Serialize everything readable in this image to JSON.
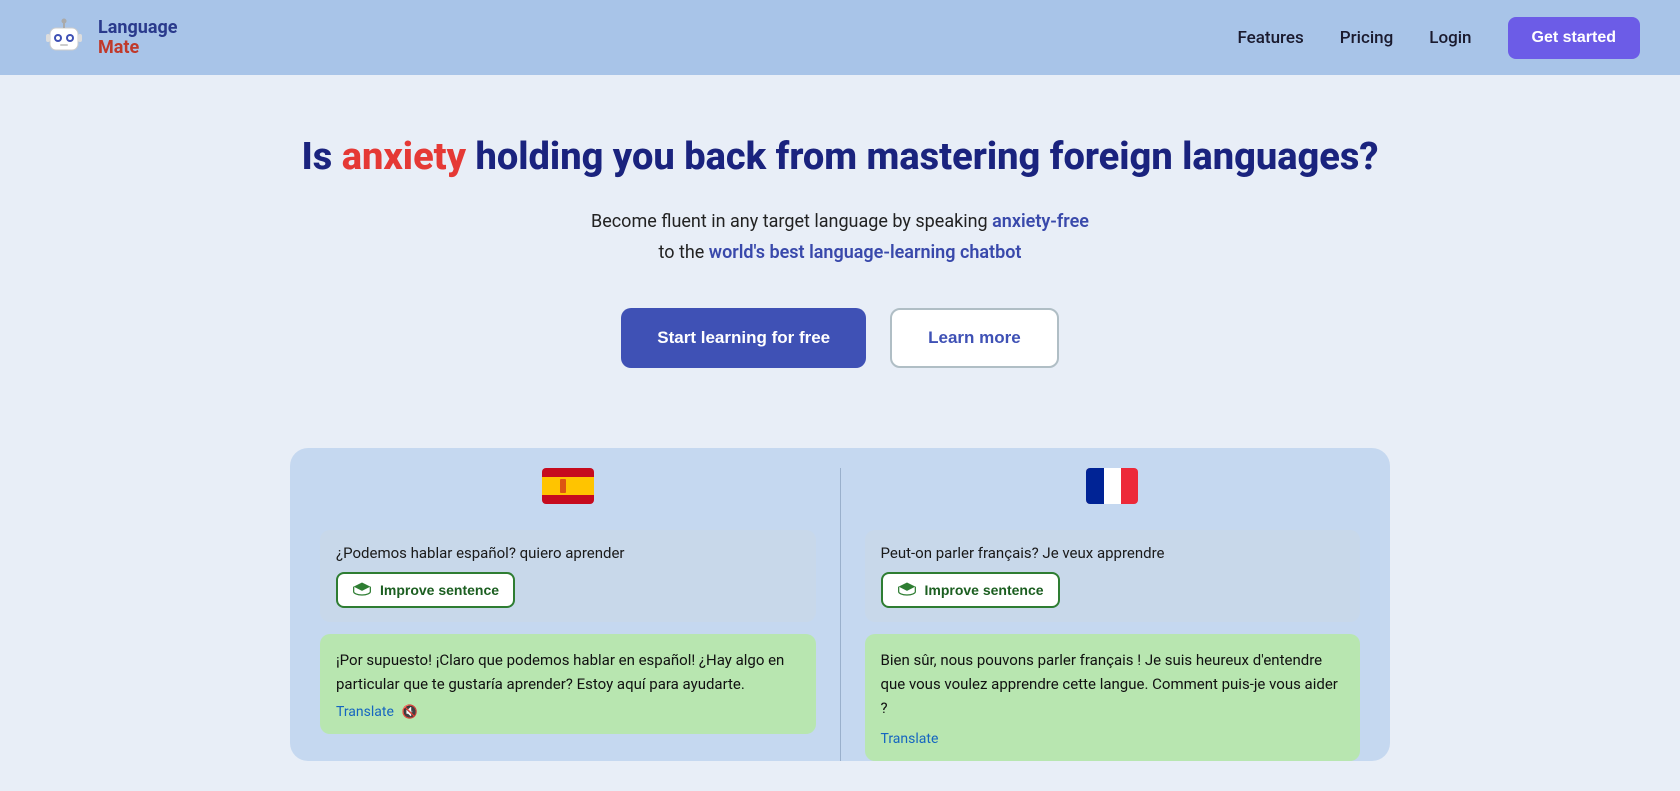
{
  "navbar": {
    "logo_language": "Language",
    "logo_mate": "Mate",
    "nav_features": "Features",
    "nav_pricing": "Pricing",
    "nav_login": "Login",
    "nav_get_started": "Get started"
  },
  "hero": {
    "heading_part1": "Is ",
    "heading_anxiety": "anxiety",
    "heading_part2": " holding you back from mastering foreign languages?",
    "sub_part1": "Become fluent in any target language by speaking ",
    "sub_anxiety_free": "anxiety-free",
    "sub_part2": " to the ",
    "sub_world_best": "world's best language-learning chatbot",
    "btn_start": "Start learning for free",
    "btn_learn": "Learn more"
  },
  "demo": {
    "es_flag": "🇪🇸",
    "fr_flag": "🇫🇷",
    "es_user_msg": "¿Podemos hablar español? quiero aprender",
    "improve_label": "Improve sentence",
    "es_bot_msg": "¡Por supuesto! ¡Claro que podemos hablar en español! ¿Hay algo en particular que te gustaría aprender? Estoy aquí para ayudarte.",
    "es_translate": "Translate",
    "fr_user_msg": "Peut-on parler français? Je veux apprendre",
    "fr_bot_msg": "Bien sûr, nous pouvons parler français ! Je suis heureux d'entendre que vous voulez apprendre cette langue. Comment puis-je vous aider ?",
    "fr_translate": "Translate"
  }
}
